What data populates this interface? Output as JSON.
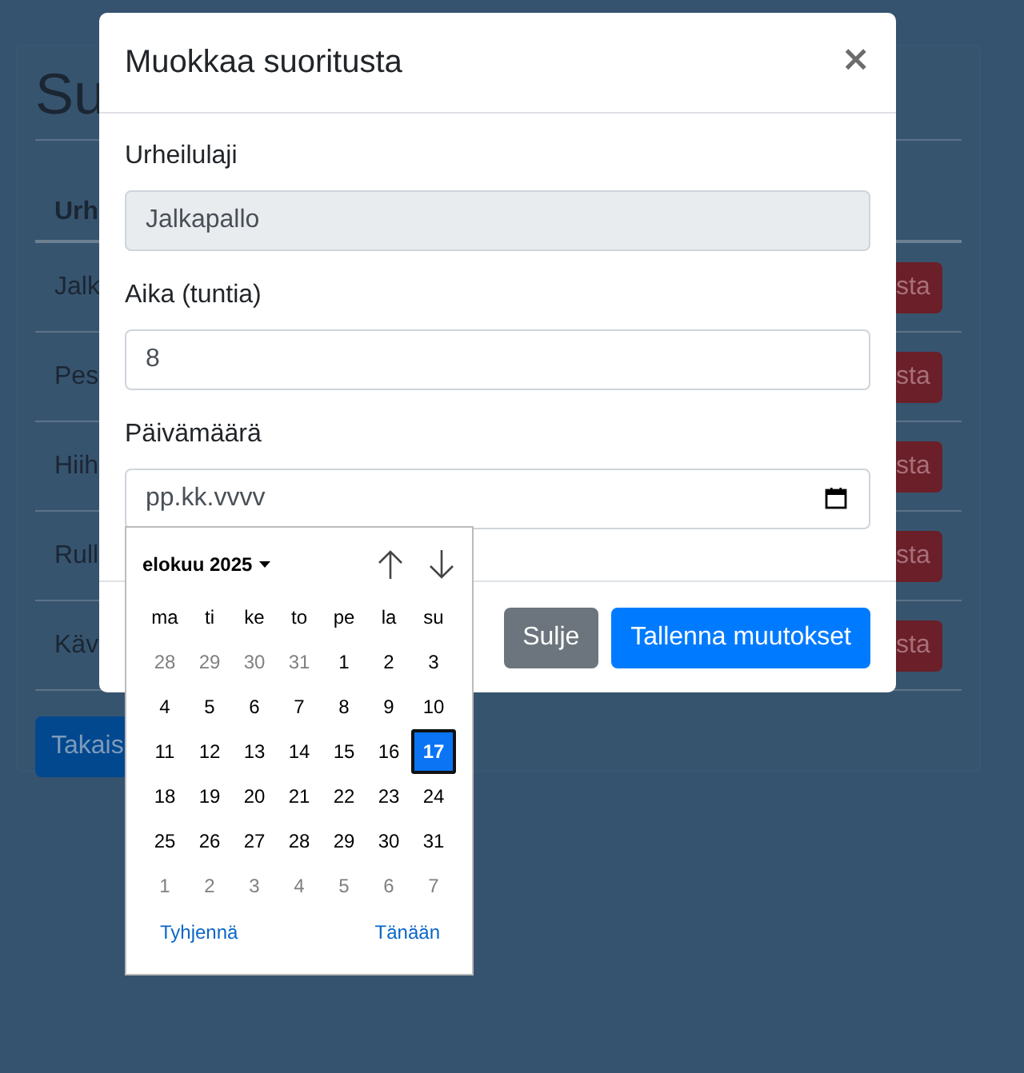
{
  "backdrop": {
    "title": "Su",
    "table": {
      "columns": [
        "Urh"
      ],
      "rows": [
        {
          "cell": "Jalk",
          "button": "sta"
        },
        {
          "cell": "Pes",
          "button": "sta"
        },
        {
          "cell": "Hiih",
          "button": "sta"
        },
        {
          "cell": "Rull",
          "button": "sta"
        },
        {
          "cell": "Käv",
          "button": "sta"
        }
      ]
    },
    "back_button": "Takais"
  },
  "modal": {
    "title": "Muokkaa suoritusta",
    "close": "×",
    "fields": [
      {
        "kind": "text",
        "label": "Urheilulaji",
        "value": "Jalkapallo",
        "disabled": true
      },
      {
        "kind": "text",
        "label": "Aika (tuntia)",
        "value": "8",
        "disabled": false
      },
      {
        "kind": "date",
        "label": "Päivämäärä",
        "placeholder": "pp.kk.vvvv",
        "disabled": false
      }
    ],
    "buttons": [
      {
        "kind": "secondary",
        "label": "Sulje"
      },
      {
        "kind": "primary",
        "label": "Tallenna muutokset"
      }
    ]
  },
  "datepicker": {
    "month": "elokuu 2025",
    "weekdays": [
      "ma",
      "ti",
      "ke",
      "to",
      "pe",
      "la",
      "su"
    ],
    "weeks": [
      [
        {
          "day": "28",
          "outside": true,
          "selected": false
        },
        {
          "day": "29",
          "outside": true,
          "selected": false
        },
        {
          "day": "30",
          "outside": true,
          "selected": false
        },
        {
          "day": "31",
          "outside": true,
          "selected": false
        },
        {
          "day": "1",
          "outside": false,
          "selected": false
        },
        {
          "day": "2",
          "outside": false,
          "selected": false
        },
        {
          "day": "3",
          "outside": false,
          "selected": false
        }
      ],
      [
        {
          "day": "4",
          "outside": false,
          "selected": false
        },
        {
          "day": "5",
          "outside": false,
          "selected": false
        },
        {
          "day": "6",
          "outside": false,
          "selected": false
        },
        {
          "day": "7",
          "outside": false,
          "selected": false
        },
        {
          "day": "8",
          "outside": false,
          "selected": false
        },
        {
          "day": "9",
          "outside": false,
          "selected": false
        },
        {
          "day": "10",
          "outside": false,
          "selected": false
        }
      ],
      [
        {
          "day": "11",
          "outside": false,
          "selected": false
        },
        {
          "day": "12",
          "outside": false,
          "selected": false
        },
        {
          "day": "13",
          "outside": false,
          "selected": false
        },
        {
          "day": "14",
          "outside": false,
          "selected": false
        },
        {
          "day": "15",
          "outside": false,
          "selected": false
        },
        {
          "day": "16",
          "outside": false,
          "selected": false
        },
        {
          "day": "17",
          "outside": false,
          "selected": true
        }
      ],
      [
        {
          "day": "18",
          "outside": false,
          "selected": false
        },
        {
          "day": "19",
          "outside": false,
          "selected": false
        },
        {
          "day": "20",
          "outside": false,
          "selected": false
        },
        {
          "day": "21",
          "outside": false,
          "selected": false
        },
        {
          "day": "22",
          "outside": false,
          "selected": false
        },
        {
          "day": "23",
          "outside": false,
          "selected": false
        },
        {
          "day": "24",
          "outside": false,
          "selected": false
        }
      ],
      [
        {
          "day": "25",
          "outside": false,
          "selected": false
        },
        {
          "day": "26",
          "outside": false,
          "selected": false
        },
        {
          "day": "27",
          "outside": false,
          "selected": false
        },
        {
          "day": "28",
          "outside": false,
          "selected": false
        },
        {
          "day": "29",
          "outside": false,
          "selected": false
        },
        {
          "day": "30",
          "outside": false,
          "selected": false
        },
        {
          "day": "31",
          "outside": false,
          "selected": false
        }
      ],
      [
        {
          "day": "1",
          "outside": true,
          "selected": false
        },
        {
          "day": "2",
          "outside": true,
          "selected": false
        },
        {
          "day": "3",
          "outside": true,
          "selected": false
        },
        {
          "day": "4",
          "outside": true,
          "selected": false
        },
        {
          "day": "5",
          "outside": true,
          "selected": false
        },
        {
          "day": "6",
          "outside": true,
          "selected": false
        },
        {
          "day": "7",
          "outside": true,
          "selected": false
        }
      ]
    ],
    "clear": "Tyhjennä",
    "today": "Tänään"
  }
}
